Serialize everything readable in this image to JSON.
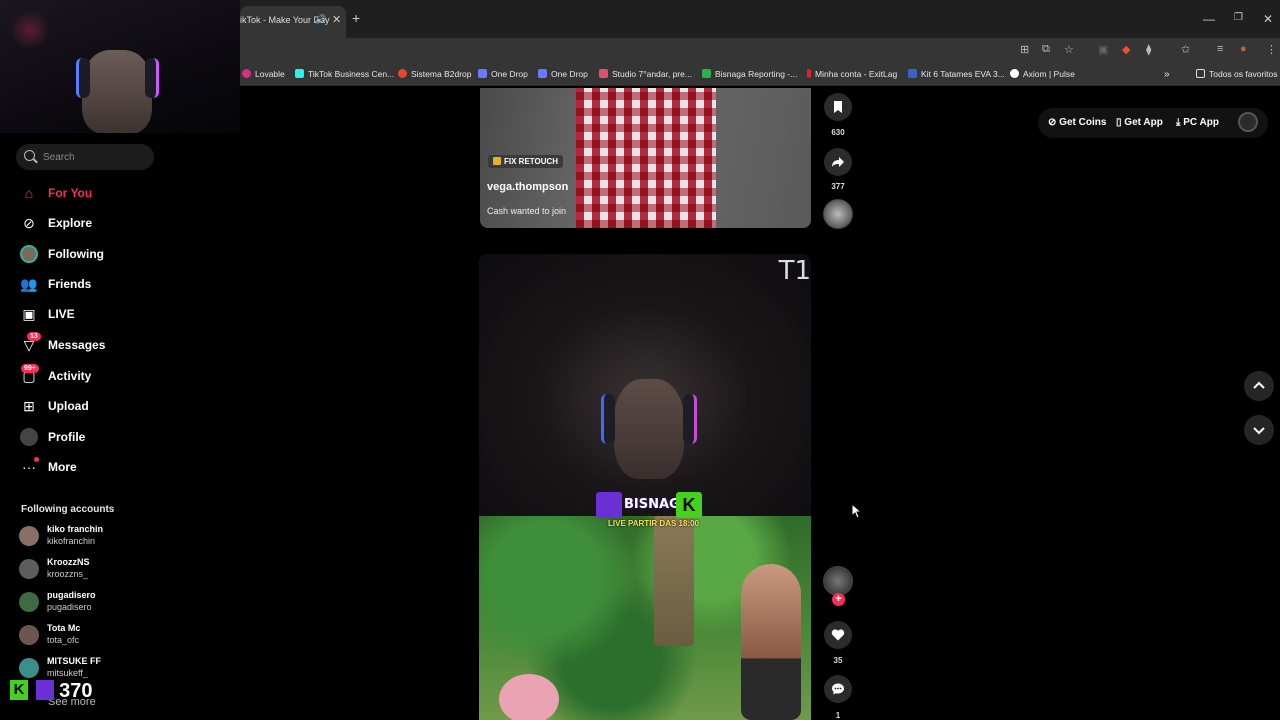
{
  "browser": {
    "tab_title": "ikTok - Make Your Day",
    "bookmarks": [
      {
        "label": "Lovable",
        "color": "#d9307e"
      },
      {
        "label": "TikTok Business Cen...",
        "color": "#25f4ee"
      },
      {
        "label": "Sistema B2drop",
        "color": "#e8452c"
      },
      {
        "label": "One Drop",
        "color": "#6b79ff"
      },
      {
        "label": "One Drop",
        "color": "#6b79ff"
      },
      {
        "label": "Studio 7°andar, pre...",
        "color": "#e14f6a"
      },
      {
        "label": "Bisnaga Reporting -...",
        "color": "#2bb24c"
      },
      {
        "label": "Minha conta - ExitLag",
        "color": "#d22"
      },
      {
        "label": "Kit 6 Tatames EVA 3...",
        "color": "#3a62c7"
      },
      {
        "label": "Axiom | Pulse",
        "color": "#ffffff"
      }
    ],
    "all_bookmarks_label": "Todos os favoritos"
  },
  "sidebar": {
    "search_placeholder": "Search",
    "nav": [
      {
        "label": "For You",
        "icon": "home-icon",
        "active": true
      },
      {
        "label": "Explore",
        "icon": "compass-icon"
      },
      {
        "label": "Following",
        "icon": "following-avatar-icon"
      },
      {
        "label": "Friends",
        "icon": "friends-icon"
      },
      {
        "label": "LIVE",
        "icon": "live-icon"
      },
      {
        "label": "Messages",
        "icon": "messages-icon",
        "badge": "13"
      },
      {
        "label": "Activity",
        "icon": "activity-icon",
        "badge": "99+"
      },
      {
        "label": "Upload",
        "icon": "upload-icon"
      },
      {
        "label": "Profile",
        "icon": "profile-avatar-icon"
      },
      {
        "label": "More",
        "icon": "more-icon"
      }
    ],
    "following_title": "Following accounts",
    "accounts": [
      {
        "name": "kiko franchin",
        "handle": "kikofranchin",
        "color": "#8a6f66"
      },
      {
        "name": "KroozzNS",
        "handle": "kroozzns_",
        "color": "#5d5d5d"
      },
      {
        "name": "pugadisero",
        "handle": "pugadisero",
        "color": "#3f6b44"
      },
      {
        "name": "Tota Mc",
        "handle": "tota_ofc",
        "color": "#6e5650"
      },
      {
        "name": "MITSUKE FF",
        "handle": "mitsukeff_",
        "color": "#3a8f88"
      }
    ],
    "see_more": "See more",
    "kick_counter": "370"
  },
  "topbar": {
    "get_coins": "Get Coins",
    "get_app": "Get App",
    "pc_app": "PC App"
  },
  "video1": {
    "badge": "FIX RETOUCH",
    "username": "vega.thompson",
    "description": "Cash wanted to join",
    "saves": "630",
    "shares": "377"
  },
  "video2": {
    "overlay_corner": "T1",
    "stream_name": "BISNAGA",
    "stream_sub": "LIVE PARTIR DAS 18:00",
    "likes": "35",
    "comments": "1"
  },
  "colors": {
    "accent": "#fe2c55",
    "kick_green": "#43d31a",
    "twitch_purple": "#6b2fd6"
  }
}
